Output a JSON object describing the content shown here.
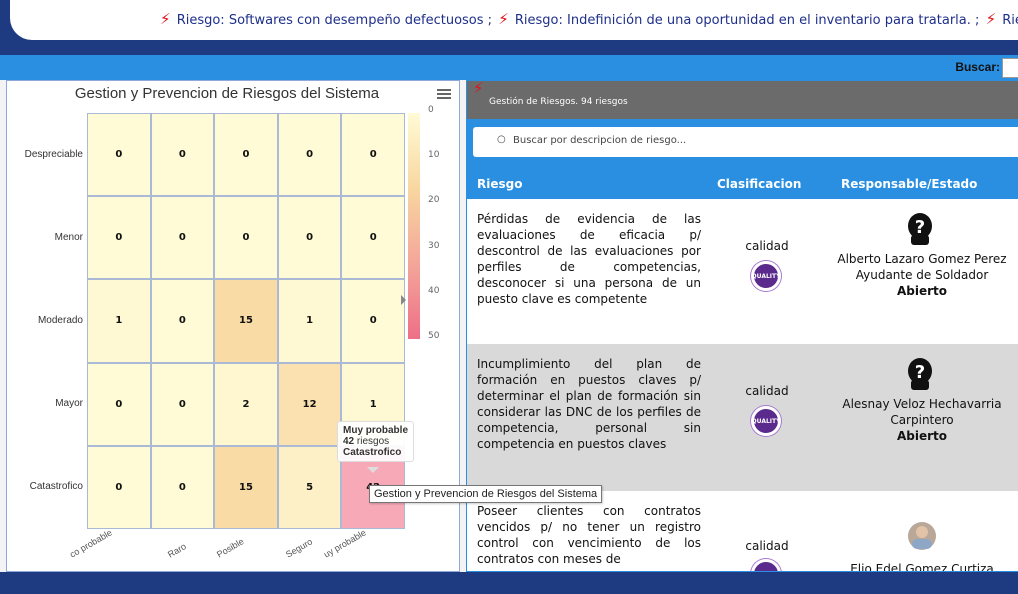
{
  "ticker": {
    "items": [
      "Riesgo: Softwares con desempeño defectuosos ;",
      "Riesgo: Indefinición de una oportunidad en el inventario para tratarla. ;",
      "Rie"
    ]
  },
  "search": {
    "label": "Buscar:"
  },
  "chart_data": {
    "type": "heatmap",
    "title": "Gestion y Prevencion de Riesgos del Sistema",
    "xcategories": [
      "Poco probable",
      "Raro",
      "Posible",
      "Seguro",
      "Muy probable"
    ],
    "xcategories_visible": [
      "co probable",
      "Raro",
      "Posible",
      "Seguro",
      "uy probable"
    ],
    "ycategories": [
      "Despreciable",
      "Menor",
      "Moderado",
      "Mayor",
      "Catastrofico"
    ],
    "values": [
      [
        0,
        0,
        0,
        0,
        0
      ],
      [
        0,
        0,
        0,
        0,
        0
      ],
      [
        1,
        0,
        15,
        1,
        0
      ],
      [
        0,
        0,
        2,
        12,
        1
      ],
      [
        0,
        0,
        15,
        5,
        42
      ]
    ],
    "colorAxis": {
      "min": 0,
      "max": 50,
      "ticks": [
        0,
        10,
        20,
        30,
        40,
        50
      ]
    },
    "tooltip": {
      "x": "Muy probable",
      "count_line": "42 riesgos",
      "count": "42",
      "riesgos_word": "riesgos",
      "y": "Catastrofico"
    }
  },
  "hover_title": "Gestion y Prevencion de Riesgos del Sistema",
  "risks_panel": {
    "header": "Gestión de Riesgos. 94 riesgos",
    "search_placeholder": "Buscar por descripcion de riesgo...",
    "columns": [
      "Riesgo",
      "Clasificacion",
      "Responsable/Estado"
    ],
    "rows": [
      {
        "description": "Pérdidas de evidencia de las evaluaciones de eficacia p/ descontrol de las evaluaciones por perfiles de competencias, desconocer si una persona de un puesto clave es competente",
        "classification": "calidad",
        "badge": "QUALITY",
        "responsible": "Alberto Lazaro Gomez Perez",
        "role": "Ayudante de Soldador",
        "status": "Abierto"
      },
      {
        "description": "Incumplimiento del plan de formación en puestos claves p/ determinar el plan de formación sin considerar las DNC de los perfiles de competencia, personal sin competencia en puestos claves",
        "classification": "calidad",
        "badge": "QUALITY",
        "responsible": "Alesnay Veloz Hechavarria",
        "role": "Carpintero",
        "status": "Abierto"
      },
      {
        "description": "Poseer clientes con contratos vencidos p/ no tener un registro control con vencimiento de los contratos con meses de",
        "classification": "calidad",
        "badge": "QUALITY",
        "responsible": "Elio Edel Gomez Curtiza",
        "role": "",
        "status": ""
      }
    ]
  },
  "colors": {
    "navy": "#1e3a80",
    "blue": "#2a8fe0",
    "header_gray": "#6b6b6b",
    "row_alt": "#d9d9d9",
    "bolt": "#e0121b"
  }
}
